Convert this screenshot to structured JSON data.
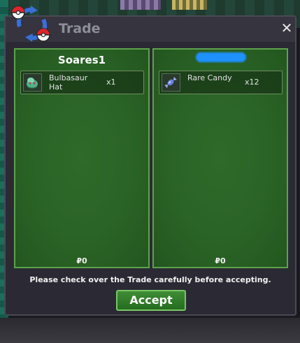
{
  "window": {
    "title": "Trade",
    "close_symbol": "✕"
  },
  "left_panel": {
    "player": "Soares1",
    "items": [
      {
        "icon": "bulbasaur-hat-icon",
        "name": "Bulbasaur Hat",
        "qty": "x1"
      }
    ],
    "money": "₽0"
  },
  "right_panel": {
    "player": "",
    "items": [
      {
        "icon": "rare-candy-icon",
        "name": "Rare Candy",
        "qty": "x12"
      }
    ],
    "money": "₽0"
  },
  "footer": {
    "notice": "Please check over the Trade carefully before accepting.",
    "accept_label": "Accept"
  },
  "colors": {
    "panel_green": "#2a6326",
    "border_green": "#5da24d",
    "accent_green": "#3f8d36"
  }
}
